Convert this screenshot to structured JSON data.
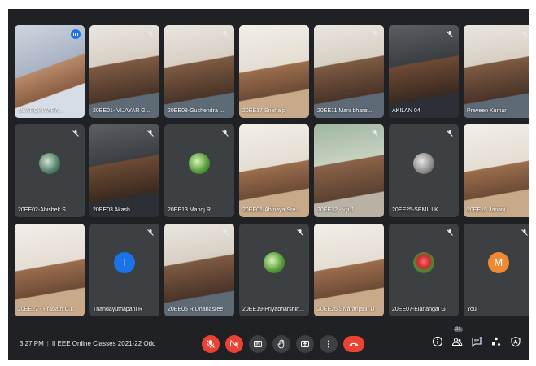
{
  "meeting": {
    "time": "3:27 PM",
    "separator": "|",
    "title": "II EEE Online Classes 2021-22 Odd",
    "participant_count": "21"
  },
  "participants": [
    {
      "name": "Mr.AROKIYARA...",
      "mic": "speaking",
      "kind": "photo-man"
    },
    {
      "name": "20EE01- VIJAYAR G...",
      "mic": "muted",
      "kind": "photo"
    },
    {
      "name": "20EE08-Gushendra ...",
      "mic": "muted",
      "kind": "photo"
    },
    {
      "name": "20EE17 Sneha p",
      "mic": "muted",
      "kind": "photo-light"
    },
    {
      "name": "20EE11 Mani bharat...",
      "mic": "muted",
      "kind": "photo"
    },
    {
      "name": "AKILAN 04",
      "mic": "muted",
      "kind": "photo-dark"
    },
    {
      "name": "Praveen Kumar",
      "mic": "muted",
      "kind": "photo"
    },
    {
      "name": "20EE02-Abishek S",
      "mic": "muted",
      "kind": "avatar-img"
    },
    {
      "name": "20EE03 Akash",
      "mic": "muted",
      "kind": "photo-dark"
    },
    {
      "name": "20EE13 Manoj.R",
      "mic": "muted",
      "kind": "avatar-img-green"
    },
    {
      "name": "20EE01-Abinaya Sre...",
      "mic": "muted",
      "kind": "photo-light"
    },
    {
      "name": "20EE32 - viji J",
      "mic": "muted",
      "kind": "photo-outdoor"
    },
    {
      "name": "20EE25-SEMILI K",
      "mic": "muted",
      "kind": "avatar-img-grey"
    },
    {
      "name": "20EE15 Janani",
      "mic": "muted",
      "kind": "photo-light"
    },
    {
      "name": "20EE27 - Prabath C.L",
      "mic": "muted",
      "kind": "photo-light"
    },
    {
      "name": "Thandayuthapani R",
      "mic": "muted",
      "kind": "letter",
      "letter": "T",
      "color": "#1a73e8"
    },
    {
      "name": "20EE06 R.Dhanasree",
      "mic": "muted",
      "kind": "photo"
    },
    {
      "name": "20EE19-Priyadharshin...",
      "mic": "muted",
      "kind": "avatar-img-green"
    },
    {
      "name": "20EE26 Sivaranjani. D",
      "mic": "muted",
      "kind": "photo-light"
    },
    {
      "name": "20EE07-Elanangai G",
      "mic": "muted",
      "kind": "avatar-img-flower"
    },
    {
      "name": "You",
      "mic": "muted",
      "kind": "letter",
      "letter": "M",
      "color": "#ef8a34"
    }
  ],
  "controls": [
    {
      "icon": "mic-off-icon",
      "state": "off"
    },
    {
      "icon": "camera-off-icon",
      "state": "off"
    },
    {
      "icon": "captions-icon",
      "state": "neutral"
    },
    {
      "icon": "raise-hand-icon",
      "state": "neutral"
    },
    {
      "icon": "present-screen-icon",
      "state": "neutral"
    },
    {
      "icon": "more-options-icon",
      "state": "neutral"
    },
    {
      "icon": "end-call-icon",
      "state": "end"
    }
  ],
  "right_icons": [
    "info-icon",
    "people-icon",
    "chat-icon",
    "activities-icon",
    "host-controls-icon"
  ],
  "colors": {
    "background": "#202124",
    "tile": "#3c4043",
    "red": "#ea4335",
    "active_border": "#8ab4f8",
    "speaking": "#1a73e8"
  }
}
